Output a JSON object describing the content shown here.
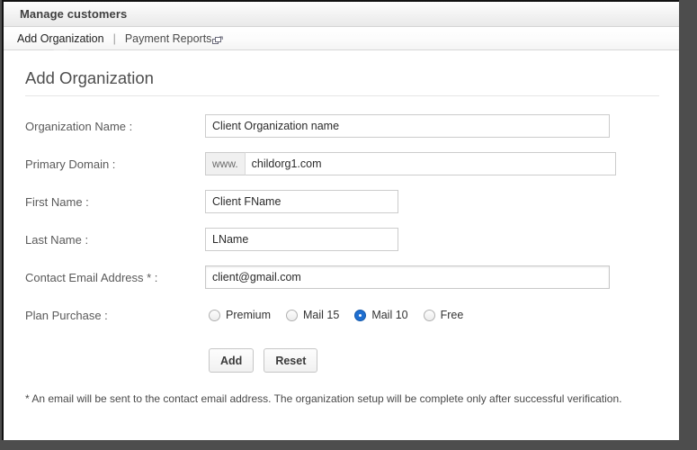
{
  "window": {
    "header_title": "Manage customers"
  },
  "tabs": {
    "active": "Add Organization",
    "items": [
      {
        "label": "Add Organization",
        "active": true,
        "popout": false
      },
      {
        "label": "Payment Reports",
        "active": false,
        "popout": true
      }
    ],
    "separator": "|",
    "popout_icon": "popout-window-icon"
  },
  "page": {
    "title": "Add Organization"
  },
  "form": {
    "fields": [
      {
        "name": "organization-name",
        "label": "Organization Name :",
        "value": "Client Organization name",
        "placeholder": "",
        "width": "wide"
      },
      {
        "name": "primary-domain",
        "label": "Primary Domain :",
        "prefix": "www.",
        "value": "childorg1.com",
        "placeholder": "",
        "width": "wide"
      },
      {
        "name": "first-name",
        "label": "First Name :",
        "value": "Client FName",
        "placeholder": "",
        "width": "narrow"
      },
      {
        "name": "last-name",
        "label": "Last Name :",
        "value": "LName",
        "placeholder": "",
        "width": "narrow"
      },
      {
        "name": "contact-email",
        "label": "Contact Email Address * :",
        "value": "client@gmail.com",
        "placeholder": "",
        "width": "wide"
      }
    ],
    "plan": {
      "label": "Plan Purchase :",
      "selected": "Mail 10",
      "options": [
        {
          "label": "Premium",
          "checked": false
        },
        {
          "label": "Mail 15",
          "checked": false
        },
        {
          "label": "Mail 10",
          "checked": true
        },
        {
          "label": "Free",
          "checked": false
        }
      ]
    },
    "buttons": {
      "submit": "Add",
      "reset": "Reset"
    },
    "footnote": "* An email will be sent to the contact email address. The organization setup will be complete only after successful verification."
  },
  "colors": {
    "accent": "#1f6fd0",
    "header_text": "#3f3f3f",
    "label_text": "#5a5a5a",
    "window_border": "#4d4d4d"
  }
}
